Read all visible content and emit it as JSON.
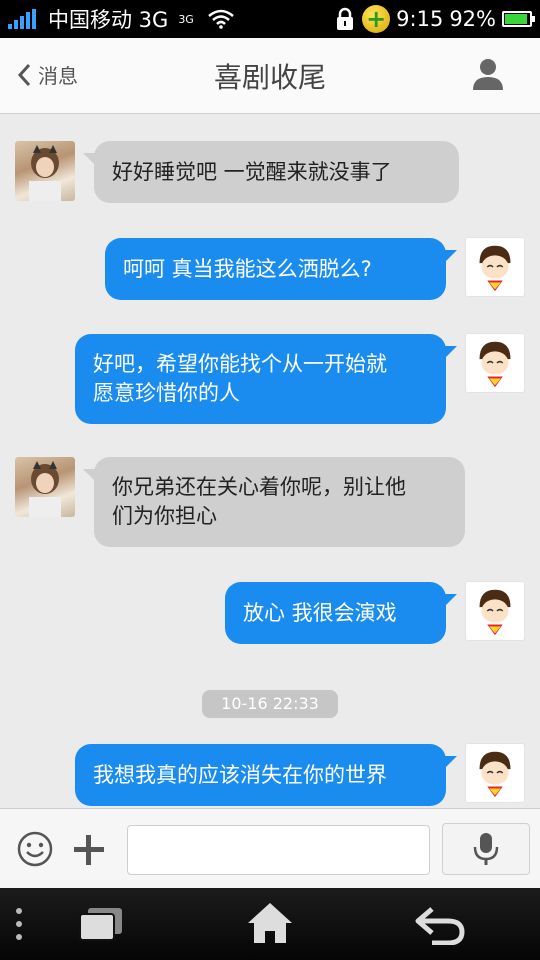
{
  "status_bar": {
    "carrier": "中国移动 3G",
    "small_network": "3G",
    "time": "9:15",
    "battery_percent": "92%",
    "battery_level": 0.92,
    "signal_color": "#3aa0ff"
  },
  "header": {
    "back_label": "消息",
    "title": "喜剧收尾",
    "profile_icon": "person-icon"
  },
  "chat": {
    "timestamp": "10-16 22:33",
    "messages": [
      {
        "side": "in",
        "lines": [
          "好好睡觉吧  一觉醒来就没事了"
        ]
      },
      {
        "side": "out",
        "lines": [
          "呵呵  真当我能这么洒脱么?"
        ]
      },
      {
        "side": "out",
        "lines": [
          "好吧，希望你能找个从一开始就",
          "愿意珍惜你的人"
        ]
      },
      {
        "side": "in",
        "lines": [
          "你兄弟还在关心着你呢，别让他",
          "们为你担心"
        ]
      },
      {
        "side": "out",
        "lines": [
          "放心  我很会演戏"
        ]
      },
      {
        "side": "out",
        "lines": [
          "我想我真的应该消失在你的世界"
        ]
      }
    ]
  },
  "input_bar": {
    "emoji_icon": "smiley-icon",
    "plus_icon": "plus-icon",
    "text_value": "",
    "mic_icon": "microphone-icon"
  },
  "nav_bar": {
    "icons": [
      "menu-icon",
      "recent-apps-icon",
      "home-icon",
      "back-icon"
    ]
  },
  "colors": {
    "outgoing_bubble": "#1a8cf0",
    "incoming_bubble": "#cfcfcf",
    "chat_background": "#ebebeb"
  }
}
